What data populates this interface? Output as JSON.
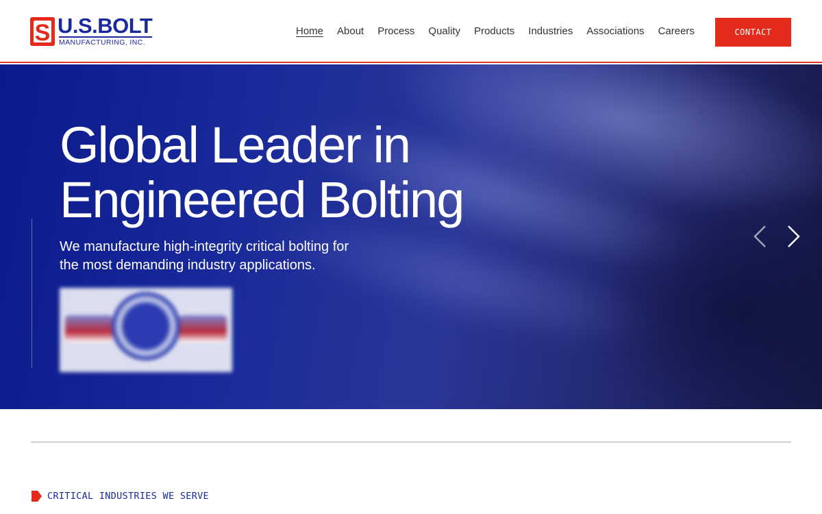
{
  "brand": {
    "name": "U.S.BOLT",
    "subtitle": "MANUFACTURING, INC.",
    "primary_color": "#1a2a9c",
    "accent_color": "#e42a1b"
  },
  "nav": {
    "items": [
      {
        "label": "Home",
        "active": true
      },
      {
        "label": "About",
        "active": false
      },
      {
        "label": "Process",
        "active": false
      },
      {
        "label": "Quality",
        "active": false
      },
      {
        "label": "Products",
        "active": false
      },
      {
        "label": "Industries",
        "active": false
      },
      {
        "label": "Associations",
        "active": false
      },
      {
        "label": "Careers",
        "active": false
      }
    ],
    "contact_label": "CONTACT"
  },
  "hero": {
    "title_line1": "Global Leader in",
    "title_line2": "Engineered Bolting",
    "subtitle_line1": "We manufacture high-integrity critical bolting for",
    "subtitle_line2": "the most demanding industry applications.",
    "prev_icon": "chevron-left-icon",
    "next_icon": "chevron-right-icon"
  },
  "section": {
    "label": "CRITICAL INDUSTRIES WE SERVE"
  }
}
